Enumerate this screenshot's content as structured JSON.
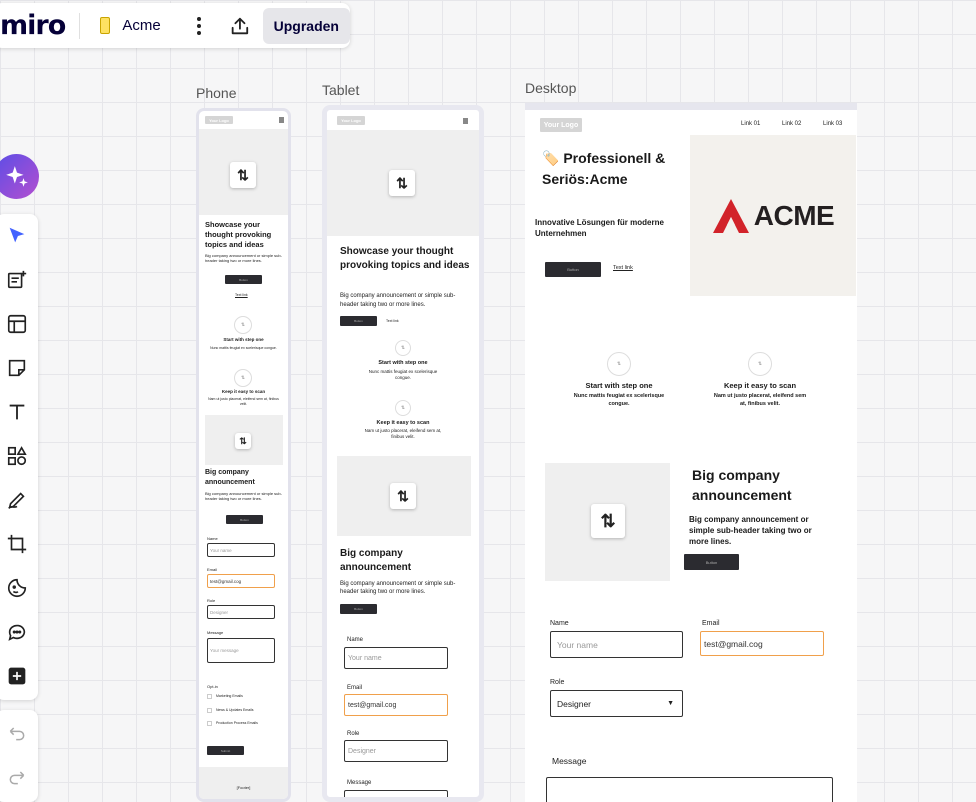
{
  "app": {
    "logo": "miro",
    "board_name": "Acme",
    "upgrade_label": "Upgraden"
  },
  "frames": {
    "phone": "Phone",
    "tablet": "Tablet",
    "desktop": "Desktop"
  },
  "icons": {
    "ai": "sparkle-icon",
    "select": "cursor-icon",
    "templates": "templates-icon",
    "frame": "frame-icon",
    "sticky": "sticky-note-icon",
    "text": "text-icon",
    "shapes": "shapes-icon",
    "pen": "pen-icon",
    "crop": "crop-icon",
    "sticker": "sticker-icon",
    "comment": "comment-icon",
    "more": "plus-icon",
    "undo": "undo-icon",
    "redo": "redo-icon",
    "share": "upload-icon",
    "swap": "swap-icon"
  },
  "colors": {
    "accent": "#4262ff",
    "brand_text": "#050038",
    "acme_red": "#d2232a",
    "input_focus": "#f0a04b",
    "button": "#2b2b30"
  },
  "swap_glyph": "⇅",
  "phone": {
    "logo": "Your Logo",
    "hero_title": "Showcase your thought provoking topics and ideas",
    "hero_sub": "Big company announcement or simple sub-header taking two or more lines.",
    "btn": "Button",
    "link": "Text link",
    "step1_title": "Start with step one",
    "step1_text": "Nunc mattis feugiat ex scelerisque congue.",
    "step2_title": "Keep it easy to scan",
    "step2_text": "Nam ut justo placerat, eleifend sem at, finibus velit.",
    "ann_title": "Big company announcement",
    "ann_sub": "Big company announcement or simple sub-header taking two or more lines.",
    "name_label": "Name",
    "name_ph": "Your name",
    "email_label": "Email",
    "email_val": "test@gmail.cog",
    "role_label": "Role",
    "role_val": "Designer",
    "msg_label": "Message",
    "msg_ph": "Your message",
    "opt_label": "Opt-in",
    "opt1": "Marketing Emails",
    "opt2": "News & Updates Emails",
    "opt3": "Production Process Emails",
    "submit": "Submit",
    "footer": "[Footer]"
  },
  "tablet": {
    "logo": "Your Logo",
    "hero_title": "Showcase your thought provoking topics and ideas",
    "hero_sub": "Big company announcement or simple sub-header taking two or more lines.",
    "btn": "Button",
    "link": "Text link",
    "step1_title": "Start with step one",
    "step1_text": "Nunc mattis feugiat ex scelerisque congue.",
    "step2_title": "Keep it easy to scan",
    "step2_text": "Nam ut justo placerat, eleifend sem at, finibus velit.",
    "ann_title": "Big company announcement",
    "ann_sub": "Big company announcement or simple sub-header taking two or more lines.",
    "name_label": "Name",
    "name_ph": "Your name",
    "email_label": "Email",
    "email_val": "test@gmail.cog",
    "role_label": "Role",
    "role_val": "Designer",
    "msg_label": "Message"
  },
  "desktop": {
    "logo": "Your Logo",
    "nav": [
      "Link 01",
      "Link 02",
      "Link 03"
    ],
    "hero_title": "🏷️ Professionell & Seriös:Acme",
    "hero_sub": "Innovative Lösungen für moderne Unternehmen",
    "btn": "Button",
    "link": "Text link",
    "brand": "ACME",
    "step1_title": "Start with step one",
    "step1_text": "Nunc mattis feugiat ex scelerisque congue.",
    "step2_title": "Keep it easy to scan",
    "step2_text": "Nam ut justo placerat, eleifend sem at, finibus velit.",
    "ann_title": "Big company announcement",
    "ann_sub": "Big company announcement or simple sub-header taking two or more lines.",
    "name_label": "Name",
    "name_ph": "Your name",
    "email_label": "Email",
    "email_val": "test@gmail.cog",
    "role_label": "Role",
    "role_val": "Designer",
    "msg_label": "Message"
  }
}
